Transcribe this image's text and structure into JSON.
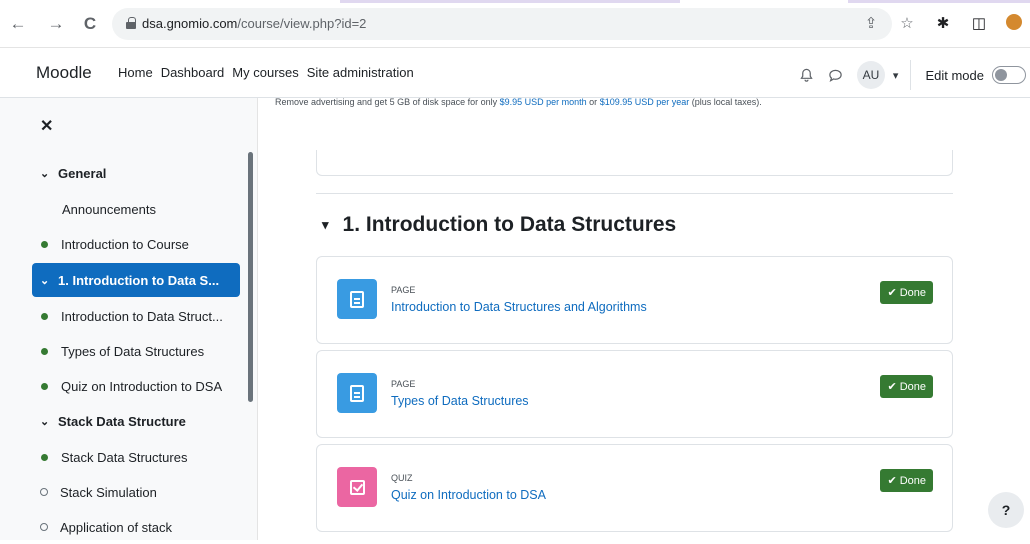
{
  "browser": {
    "url_domain": "dsa.gnomio.com",
    "url_path": "/course/view.php?id=2",
    "back_glyph": "←",
    "forward_glyph": "→",
    "reload_glyph": "C",
    "share_glyph": "⇪",
    "star_glyph": "☆",
    "extensions_glyph": "✱",
    "sidepanel_glyph": "◫"
  },
  "topnav": {
    "brand": "Moodle",
    "links": [
      "Home",
      "Dashboard",
      "My courses",
      "Site administration"
    ],
    "bell_glyph": "🔔︎",
    "chat_glyph": "◌",
    "user_initials": "AU",
    "user_caret": "⌄",
    "edit_mode_label": "Edit mode",
    "edit_mode_on": false
  },
  "sidebar": {
    "close_glyph": "✕",
    "items": [
      {
        "label": "General",
        "kind": "section",
        "expanded": true
      },
      {
        "label": "Announcements",
        "kind": "plain"
      },
      {
        "label": "Introduction to Course",
        "kind": "done"
      },
      {
        "label": "1. Introduction to Data S...",
        "kind": "section",
        "expanded": true,
        "active": true
      },
      {
        "label": "Introduction to Data Struct...",
        "kind": "done"
      },
      {
        "label": "Types of Data Structures",
        "kind": "done"
      },
      {
        "label": "Quiz on Introduction to DSA",
        "kind": "done"
      },
      {
        "label": "Stack Data Structure",
        "kind": "section",
        "expanded": true
      },
      {
        "label": "Stack Data Structures",
        "kind": "done"
      },
      {
        "label": "Stack Simulation",
        "kind": "todo"
      },
      {
        "label": "Application of stack",
        "kind": "todo"
      }
    ]
  },
  "main": {
    "ad": {
      "prefix": "Remove advertising and get 5 GB of disk space for only ",
      "monthly": "$9.95 USD per month",
      "middle": " or ",
      "yearly": "$109.95 USD per year",
      "suffix": " (plus local taxes)."
    },
    "section_chevron": "⌄",
    "section_title": "1. Introduction to Data Structures",
    "activities": [
      {
        "type": "PAGE",
        "icon": "page-icon",
        "name": "Introduction to Data Structures and Algorithms",
        "status": "Done"
      },
      {
        "type": "PAGE",
        "icon": "page-icon",
        "name": "Types of Data Structures",
        "status": "Done"
      },
      {
        "type": "QUIZ",
        "icon": "quiz-icon",
        "name": "Quiz on Introduction to DSA",
        "status": "Done"
      }
    ],
    "done_tick": "✔"
  },
  "help": {
    "label": "?"
  },
  "colors": {
    "primary": "#0f6cbf",
    "success": "#357a32",
    "page_icon": "#399be2",
    "quiz_icon": "#eb66a2"
  }
}
